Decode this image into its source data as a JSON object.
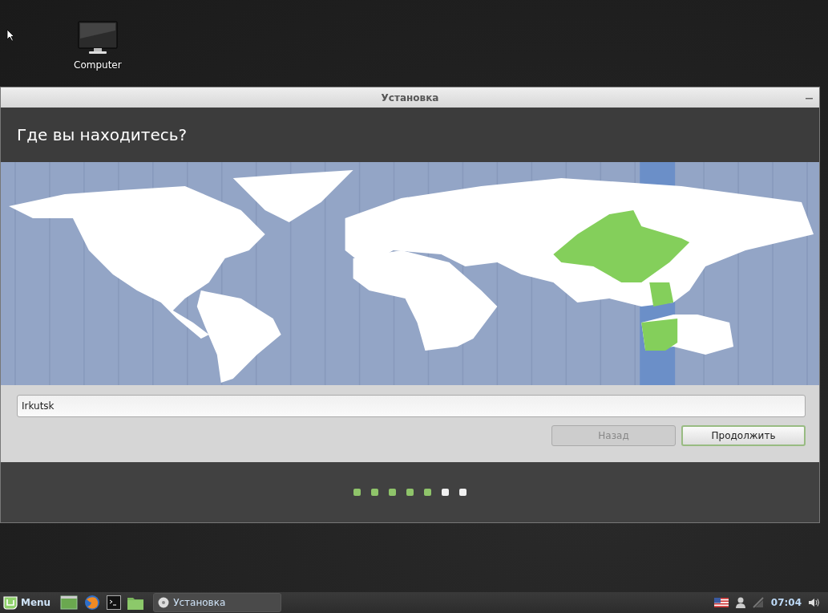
{
  "desktop_icons": [
    {
      "label": "Computer"
    }
  ],
  "window": {
    "title": "Установка",
    "heading": "Где вы находитесь?"
  },
  "location_field": {
    "value": "Irkutsk"
  },
  "buttons": [
    {
      "label": "Назад",
      "disabled": true,
      "default": false
    },
    {
      "label": "Продолжить",
      "disabled": false,
      "default": true
    }
  ],
  "progress_steps": [
    {
      "completed": true
    },
    {
      "completed": true
    },
    {
      "completed": true
    },
    {
      "completed": true
    },
    {
      "completed": true
    },
    {
      "completed": false
    },
    {
      "completed": false
    }
  ],
  "taskbar": {
    "menu_label": "Menu",
    "window_button": "Установка",
    "clock": "07:04"
  }
}
